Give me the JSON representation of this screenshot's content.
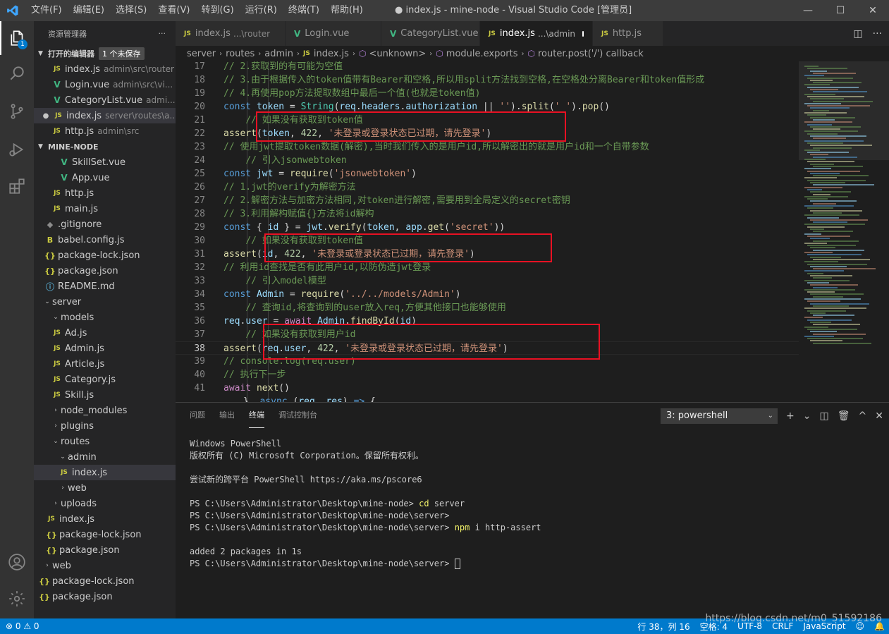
{
  "titlebar": {
    "menus": [
      "文件(F)",
      "编辑(E)",
      "选择(S)",
      "查看(V)",
      "转到(G)",
      "运行(R)",
      "终端(T)",
      "帮助(H)"
    ],
    "title": "● index.js - mine-node - Visual Studio Code [管理员]",
    "minimize": "—",
    "maximize": "☐",
    "close": "✕"
  },
  "activity": {
    "explorer_badge": "1"
  },
  "sidebar": {
    "header": "资源管理器",
    "more": "···",
    "open_editors": {
      "title": "打开的编辑器",
      "unsaved": "1 个未保存",
      "items": [
        {
          "icon": "JS",
          "name": "index.js",
          "desc": "admin\\src\\router"
        },
        {
          "icon": "V",
          "name": "Login.vue",
          "desc": "admin\\src\\vi..."
        },
        {
          "icon": "V",
          "name": "CategoryList.vue",
          "desc": "admi..."
        },
        {
          "icon": "JS",
          "name": "index.js",
          "desc": "server\\routes\\a..."
        },
        {
          "icon": "JS",
          "name": "http.js",
          "desc": "admin\\src"
        }
      ]
    },
    "project": {
      "title": "MINE-NODE",
      "items": [
        {
          "icon": "V",
          "name": "SkillSet.vue"
        },
        {
          "icon": "V",
          "name": "App.vue"
        },
        {
          "icon": "JS",
          "name": "http.js"
        },
        {
          "icon": "JS",
          "name": "main.js"
        },
        {
          "icon": "◆",
          "name": ".gitignore"
        },
        {
          "icon": "B",
          "name": "babel.config.js"
        },
        {
          "icon": "{}",
          "name": "package-lock.json"
        },
        {
          "icon": "{}",
          "name": "package.json"
        },
        {
          "icon": "ⓘ",
          "name": "README.md"
        },
        {
          "icon": "",
          "name": "server"
        },
        {
          "icon": "",
          "name": "models"
        },
        {
          "icon": "JS",
          "name": "Ad.js"
        },
        {
          "icon": "JS",
          "name": "Admin.js"
        },
        {
          "icon": "JS",
          "name": "Article.js"
        },
        {
          "icon": "JS",
          "name": "Category.js"
        },
        {
          "icon": "JS",
          "name": "Skill.js"
        },
        {
          "icon": "",
          "name": "node_modules"
        },
        {
          "icon": "",
          "name": "plugins"
        },
        {
          "icon": "",
          "name": "routes"
        },
        {
          "icon": "",
          "name": "admin"
        },
        {
          "icon": "JS",
          "name": "index.js"
        },
        {
          "icon": "",
          "name": "web"
        },
        {
          "icon": "",
          "name": "uploads"
        },
        {
          "icon": "JS",
          "name": "index.js"
        },
        {
          "icon": "{}",
          "name": "package-lock.json"
        },
        {
          "icon": "{}",
          "name": "package.json"
        },
        {
          "icon": "",
          "name": "web"
        },
        {
          "icon": "{}",
          "name": "package-lock.json"
        },
        {
          "icon": "{}",
          "name": "package.json"
        }
      ]
    }
  },
  "tabs": [
    {
      "icon": "JS",
      "name": "index.js",
      "desc": "...\\router"
    },
    {
      "icon": "V",
      "name": "Login.vue",
      "desc": ""
    },
    {
      "icon": "V",
      "name": "CategoryList.vue",
      "desc": ""
    },
    {
      "icon": "JS",
      "name": "index.js",
      "desc": "...\\admin"
    },
    {
      "icon": "JS",
      "name": "http.js",
      "desc": ""
    }
  ],
  "breadcrumb": {
    "parts": [
      "server",
      "routes",
      "admin"
    ],
    "file_icon": "JS",
    "file": "index.js",
    "symbols": [
      "<unknown>",
      "module.exports",
      "router.post('/') callback"
    ]
  },
  "editor": {
    "line_numbers": [
      "17",
      "18",
      "19",
      "20",
      "21",
      "22",
      "23",
      "24",
      "25",
      "26",
      "27",
      "28",
      "29",
      "30",
      "31",
      "32",
      "33",
      "34",
      "35",
      "36",
      "37",
      "38",
      "39",
      "40",
      "41"
    ]
  },
  "panel": {
    "tabs": [
      "问题",
      "输出",
      "终端",
      "调试控制台"
    ],
    "terminal_select": "3: powershell",
    "actions": [
      "+",
      "⌄",
      "◫",
      "🗑",
      "^",
      "✕"
    ],
    "terminal_lines": [
      "Windows PowerShell",
      "版权所有 (C) Microsoft Corporation。保留所有权利。",
      "",
      "尝试新的跨平台 PowerShell https://aka.ms/pscore6",
      "",
      "PS C:\\Users\\Administrator\\Desktop\\mine-node> ",
      "PS C:\\Users\\Administrator\\Desktop\\mine-node\\server>",
      "PS C:\\Users\\Administrator\\Desktop\\mine-node\\server> ",
      "",
      "added 2 packages in 1s",
      "PS C:\\Users\\Administrator\\Desktop\\mine-node\\server> "
    ],
    "cmd_cd": "cd",
    "cmd_cd_arg": " server",
    "cmd_npm": "npm",
    "cmd_npm_arg": " i http-assert"
  },
  "statusbar": {
    "problems": "⊗ 0 ⚠ 0",
    "position": "行 38，列 16",
    "spaces": "空格: 4",
    "encoding": "UTF-8",
    "eol": "CRLF",
    "language": "JavaScript"
  },
  "watermark": "https://blog.csdn.net/m0_51592186",
  "colors": {
    "accent": "#007acc",
    "highlight_box": "#e81123"
  }
}
